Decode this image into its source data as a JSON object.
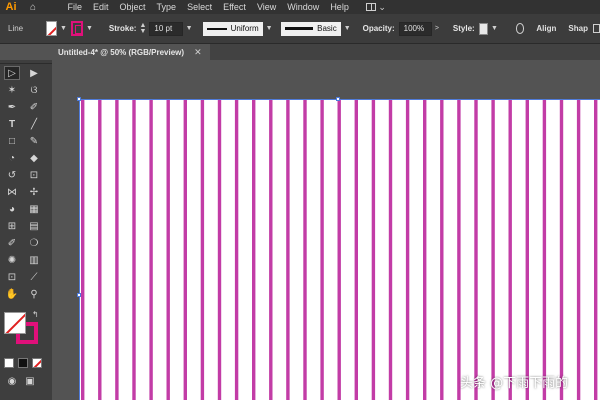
{
  "app": {
    "logo": "Ai",
    "menu": [
      "File",
      "Edit",
      "Object",
      "Type",
      "Select",
      "Effect",
      "View",
      "Window",
      "Help"
    ]
  },
  "control_bar": {
    "selection_label": "Line",
    "stroke_label": "Stroke:",
    "stroke_weight": "10 pt",
    "profile_label": "Uniform",
    "brush_label": "Basic",
    "opacity_label": "Opacity:",
    "opacity_value": "100%",
    "style_label": "Style:",
    "align_label": "Align",
    "shape_label": "Shap"
  },
  "document": {
    "tab_title": "Untitled-4* @ 50% (RGB/Preview)",
    "close_glyph": "✕"
  },
  "colors": {
    "stroke": "#e0107a",
    "line": "#c23ca6",
    "fill_none_slash": "#e02020",
    "artboard": "#ffffff"
  },
  "artwork": {
    "line_count": 31
  },
  "watermark": "头条 @下雨下雨的"
}
